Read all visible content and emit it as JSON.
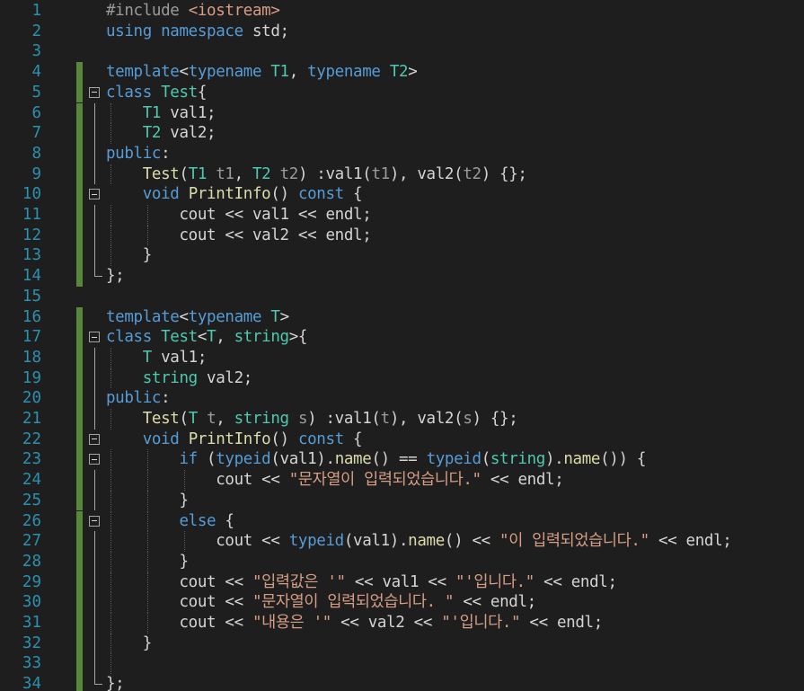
{
  "editor": {
    "lines": [
      {
        "n": "1",
        "tokens": [
          [
            "pp",
            "#include "
          ],
          [
            "s",
            "<iostream>"
          ]
        ]
      },
      {
        "n": "2",
        "tokens": [
          [
            "k",
            "using"
          ],
          [
            "d",
            " "
          ],
          [
            "k",
            "namespace"
          ],
          [
            "d",
            " std;"
          ]
        ]
      },
      {
        "n": "3",
        "tokens": []
      },
      {
        "n": "4",
        "tokens": [
          [
            "k",
            "template"
          ],
          [
            "d",
            "<"
          ],
          [
            "k",
            "typename"
          ],
          [
            "d",
            " "
          ],
          [
            "t",
            "T1"
          ],
          [
            "d",
            ", "
          ],
          [
            "k",
            "typename"
          ],
          [
            "d",
            " "
          ],
          [
            "t",
            "T2"
          ],
          [
            "d",
            ">"
          ]
        ]
      },
      {
        "n": "5",
        "tokens": [
          [
            "k",
            "class"
          ],
          [
            "d",
            " "
          ],
          [
            "t",
            "Test"
          ],
          [
            "d",
            "{"
          ]
        ]
      },
      {
        "n": "6",
        "tokens": [
          [
            "d",
            "    "
          ],
          [
            "t",
            "T1"
          ],
          [
            "d",
            " val1;"
          ]
        ]
      },
      {
        "n": "7",
        "tokens": [
          [
            "d",
            "    "
          ],
          [
            "t",
            "T2"
          ],
          [
            "d",
            " val2;"
          ]
        ]
      },
      {
        "n": "8",
        "tokens": [
          [
            "k",
            "public"
          ],
          [
            "d",
            ":"
          ]
        ]
      },
      {
        "n": "9",
        "tokens": [
          [
            "d",
            "    "
          ],
          [
            "f",
            "Test"
          ],
          [
            "d",
            "("
          ],
          [
            "t",
            "T1"
          ],
          [
            "d",
            " "
          ],
          [
            "p",
            "t1"
          ],
          [
            "d",
            ", "
          ],
          [
            "t",
            "T2"
          ],
          [
            "d",
            " "
          ],
          [
            "p",
            "t2"
          ],
          [
            "d",
            ") :val1("
          ],
          [
            "p",
            "t1"
          ],
          [
            "d",
            "), val2("
          ],
          [
            "p",
            "t2"
          ],
          [
            "d",
            ") {};"
          ]
        ]
      },
      {
        "n": "10",
        "tokens": [
          [
            "d",
            "    "
          ],
          [
            "k",
            "void"
          ],
          [
            "d",
            " "
          ],
          [
            "f",
            "PrintInfo"
          ],
          [
            "d",
            "() "
          ],
          [
            "k",
            "const"
          ],
          [
            "d",
            " {"
          ]
        ]
      },
      {
        "n": "11",
        "tokens": [
          [
            "d",
            "        cout << val1 << endl;"
          ]
        ]
      },
      {
        "n": "12",
        "tokens": [
          [
            "d",
            "        cout << val2 << endl;"
          ]
        ]
      },
      {
        "n": "13",
        "tokens": [
          [
            "d",
            "    }"
          ]
        ]
      },
      {
        "n": "14",
        "tokens": [
          [
            "d",
            "};"
          ]
        ]
      },
      {
        "n": "15",
        "tokens": []
      },
      {
        "n": "16",
        "tokens": [
          [
            "k",
            "template"
          ],
          [
            "d",
            "<"
          ],
          [
            "k",
            "typename"
          ],
          [
            "d",
            " "
          ],
          [
            "t",
            "T"
          ],
          [
            "d",
            ">"
          ]
        ]
      },
      {
        "n": "17",
        "tokens": [
          [
            "k",
            "class"
          ],
          [
            "d",
            " "
          ],
          [
            "t",
            "Test"
          ],
          [
            "d",
            "<"
          ],
          [
            "t",
            "T"
          ],
          [
            "d",
            ", "
          ],
          [
            "t",
            "string"
          ],
          [
            "d",
            ">{"
          ]
        ]
      },
      {
        "n": "18",
        "tokens": [
          [
            "d",
            "    "
          ],
          [
            "t",
            "T"
          ],
          [
            "d",
            " val1;"
          ]
        ]
      },
      {
        "n": "19",
        "tokens": [
          [
            "d",
            "    "
          ],
          [
            "t",
            "string"
          ],
          [
            "d",
            " val2;"
          ]
        ]
      },
      {
        "n": "20",
        "tokens": [
          [
            "k",
            "public"
          ],
          [
            "d",
            ":"
          ]
        ]
      },
      {
        "n": "21",
        "tokens": [
          [
            "d",
            "    "
          ],
          [
            "f",
            "Test"
          ],
          [
            "d",
            "("
          ],
          [
            "t",
            "T"
          ],
          [
            "d",
            " "
          ],
          [
            "p",
            "t"
          ],
          [
            "d",
            ", "
          ],
          [
            "t",
            "string"
          ],
          [
            "d",
            " "
          ],
          [
            "p",
            "s"
          ],
          [
            "d",
            ") :val1("
          ],
          [
            "p",
            "t"
          ],
          [
            "d",
            "), val2("
          ],
          [
            "p",
            "s"
          ],
          [
            "d",
            ") {};"
          ]
        ]
      },
      {
        "n": "22",
        "tokens": [
          [
            "d",
            "    "
          ],
          [
            "k",
            "void"
          ],
          [
            "d",
            " "
          ],
          [
            "f",
            "PrintInfo"
          ],
          [
            "d",
            "() "
          ],
          [
            "k",
            "const"
          ],
          [
            "d",
            " {"
          ]
        ]
      },
      {
        "n": "23",
        "tokens": [
          [
            "d",
            "        "
          ],
          [
            "k",
            "if"
          ],
          [
            "d",
            " ("
          ],
          [
            "k",
            "typeid"
          ],
          [
            "d",
            "(val1)."
          ],
          [
            "f",
            "name"
          ],
          [
            "d",
            "() == "
          ],
          [
            "k",
            "typeid"
          ],
          [
            "d",
            "("
          ],
          [
            "t",
            "string"
          ],
          [
            "d",
            ")."
          ],
          [
            "f",
            "name"
          ],
          [
            "d",
            "()) {"
          ]
        ]
      },
      {
        "n": "24",
        "tokens": [
          [
            "d",
            "            cout << "
          ],
          [
            "s",
            "\"문자열이 입력되었습니다.\""
          ],
          [
            "d",
            " << endl;"
          ]
        ]
      },
      {
        "n": "25",
        "tokens": [
          [
            "d",
            "        }"
          ]
        ]
      },
      {
        "n": "26",
        "tokens": [
          [
            "d",
            "        "
          ],
          [
            "k",
            "else"
          ],
          [
            "d",
            " {"
          ]
        ]
      },
      {
        "n": "27",
        "tokens": [
          [
            "d",
            "            cout << "
          ],
          [
            "k",
            "typeid"
          ],
          [
            "d",
            "(val1)."
          ],
          [
            "f",
            "name"
          ],
          [
            "d",
            "() << "
          ],
          [
            "s",
            "\"이 입력되었습니다.\""
          ],
          [
            "d",
            " << endl;"
          ]
        ]
      },
      {
        "n": "28",
        "tokens": [
          [
            "d",
            "        }"
          ]
        ]
      },
      {
        "n": "29",
        "tokens": [
          [
            "d",
            "        cout << "
          ],
          [
            "s",
            "\"입력값은 '\""
          ],
          [
            "d",
            " << val1 << "
          ],
          [
            "s",
            "\"'입니다.\""
          ],
          [
            "d",
            " << endl;"
          ]
        ]
      },
      {
        "n": "30",
        "tokens": [
          [
            "d",
            "        cout << "
          ],
          [
            "s",
            "\"문자열이 입력되었습니다. \""
          ],
          [
            "d",
            " << endl;"
          ]
        ]
      },
      {
        "n": "31",
        "tokens": [
          [
            "d",
            "        cout << "
          ],
          [
            "s",
            "\"내용은 '\""
          ],
          [
            "d",
            " << val2 << "
          ],
          [
            "s",
            "\"'입니다.\""
          ],
          [
            "d",
            " << endl;"
          ]
        ]
      },
      {
        "n": "32",
        "tokens": [
          [
            "d",
            "    }"
          ]
        ]
      },
      {
        "n": "33",
        "tokens": []
      },
      {
        "n": "34",
        "tokens": [
          [
            "d",
            "};"
          ]
        ]
      }
    ]
  },
  "colors": {
    "background": "#1e1e1e",
    "line_number": "#2b91af",
    "modified_marker": "#57873b",
    "keyword": "#569cd6",
    "type": "#4ec9b0",
    "function": "#dcdcaa",
    "string": "#d69d85",
    "parameter": "#9b9b9b",
    "default_text": "#d4d4d4"
  }
}
